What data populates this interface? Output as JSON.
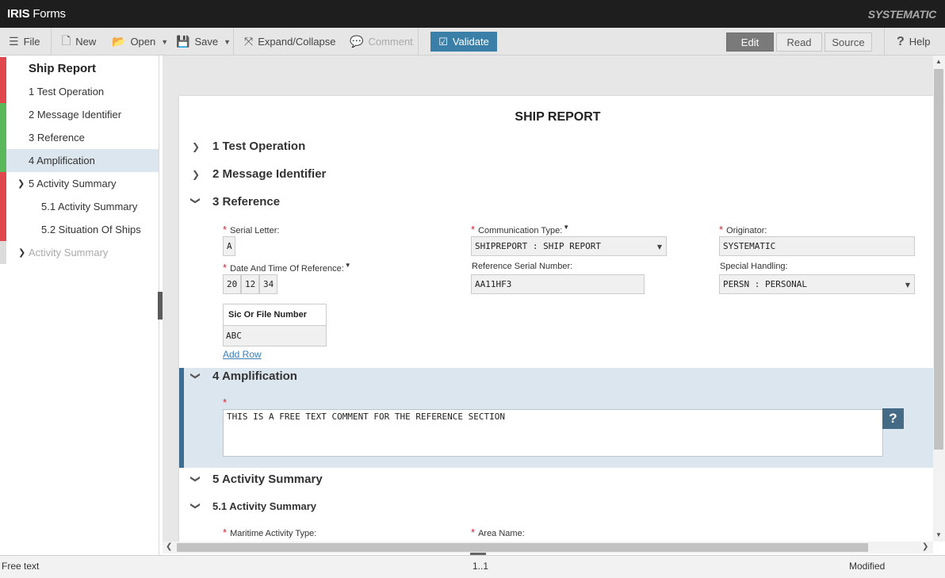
{
  "titlebar": {
    "app_bold": "IRIS",
    "app_rest": " Forms",
    "brand": "SYSTEMATIC"
  },
  "toolbar": {
    "file": "File",
    "new": "New",
    "open": "Open",
    "save": "Save",
    "expand_collapse": "Expand/Collapse",
    "comment": "Comment",
    "validate": "Validate",
    "modes": [
      "Edit",
      "Read",
      "Source"
    ],
    "active_mode": "Edit",
    "help": "Help"
  },
  "sidebar": {
    "title": "Ship Report",
    "items": [
      {
        "label": "1 Test Operation",
        "status": "error"
      },
      {
        "label": "2 Message Identifier",
        "status": "valid"
      },
      {
        "label": "3 Reference",
        "status": "valid"
      },
      {
        "label": "4 Amplification",
        "status": "valid",
        "selected": true
      },
      {
        "label": "5 Activity Summary",
        "status": "error",
        "expanded": true
      },
      {
        "label": "5.1 Activity Summary",
        "status": "error"
      },
      {
        "label": "5.2 Situation Of Ships",
        "status": "error"
      },
      {
        "label": "Activity Summary",
        "status": "disabled"
      }
    ],
    "colors": {
      "error": "#e0474c",
      "valid": "#59b85a",
      "disabled": "#dcdcdc"
    }
  },
  "form": {
    "title": "SHIP REPORT",
    "sections": {
      "s1": "1 Test Operation",
      "s2": "2 Message Identifier",
      "s3": "3 Reference",
      "s4": "4 Amplification",
      "s5": "5 Activity Summary",
      "s51": "5.1 Activity Summary"
    },
    "reference": {
      "serial_letter_label": "Serial Letter:",
      "serial_letter_value": "A",
      "comm_type_label": "Communication Type:",
      "comm_type_value": "SHIPREPORT : SHIP REPORT",
      "originator_label": "Originator:",
      "originator_value": "SYSTEMATIC",
      "dtg_label": "Date And Time Of Reference:",
      "dtg_values": [
        "20",
        "12",
        "34"
      ],
      "ref_serial_label": "Reference Serial Number:",
      "ref_serial_value": "AA11HF3",
      "special_handling_label": "Special Handling:",
      "special_handling_value": "PERSN : PERSONAL",
      "sic_header": "Sic Or File Number",
      "sic_value": "ABC",
      "add_row": "Add Row"
    },
    "amplification": {
      "required": "*",
      "text": "THIS IS A FREE TEXT COMMENT FOR THE REFERENCE SECTION",
      "help": "?"
    },
    "activity": {
      "maritime_label": "Maritime Activity Type:",
      "area_label": "Area Name:"
    }
  },
  "status": {
    "left": "Free text",
    "center": "1..1",
    "right": "Modified"
  }
}
